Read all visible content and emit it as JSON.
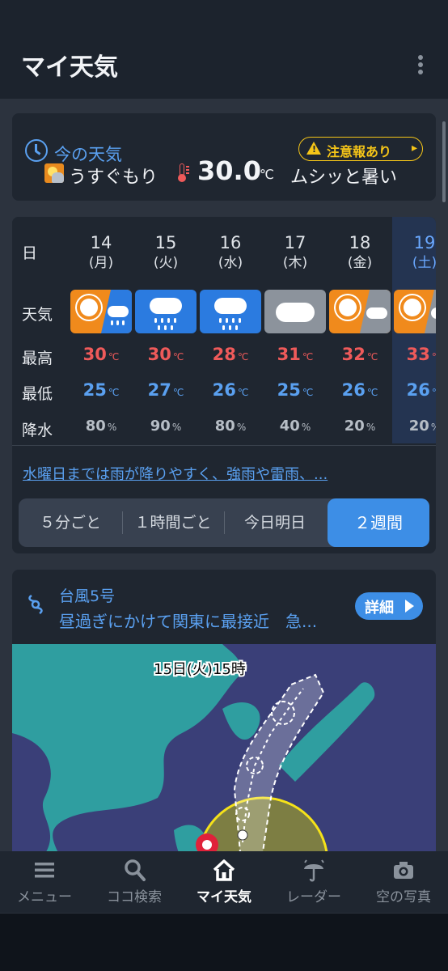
{
  "app": {
    "title": "マイ天気"
  },
  "current": {
    "label": "今の天気",
    "alert": "注意報あり",
    "condition": "うすぐもり",
    "temperature": "30.0",
    "unit": "℃",
    "feel": "ムシッと暑い"
  },
  "forecast": {
    "row_labels": {
      "day": "日",
      "weather": "天気",
      "high": "最高",
      "low": "最低",
      "rain": "降水"
    },
    "days": [
      {
        "day": "14",
        "weekday": "(月)",
        "icon": "sun-then-rain",
        "high": "30",
        "low": "25",
        "rain": "80"
      },
      {
        "day": "15",
        "weekday": "(火)",
        "icon": "rain",
        "high": "30",
        "low": "27",
        "rain": "90"
      },
      {
        "day": "16",
        "weekday": "(水)",
        "icon": "rain",
        "high": "28",
        "low": "26",
        "rain": "80"
      },
      {
        "day": "17",
        "weekday": "(木)",
        "icon": "cloudy",
        "high": "31",
        "low": "25",
        "rain": "40"
      },
      {
        "day": "18",
        "weekday": "(金)",
        "icon": "sun-then-cloud",
        "high": "32",
        "low": "26",
        "rain": "20"
      },
      {
        "day": "19",
        "weekday": "(土)",
        "icon": "sun-then-cloud",
        "high": "33",
        "low": "26",
        "rain": "20"
      }
    ],
    "temp_unit": "℃",
    "rain_unit": "%",
    "summary": "水曜日までは雨が降りやすく、強雨や雷雨、...",
    "tabs": [
      "５分ごと",
      "１時間ごと",
      "今日明日",
      "２週間"
    ],
    "selected_tab": "２週間"
  },
  "typhoon": {
    "title": "台風5号",
    "text": "昼過ぎにかけて関東に最接近　急...",
    "detail_label": "詳細",
    "map_label": "15日(火)15時"
  },
  "nav": {
    "items": [
      {
        "label": "メニュー",
        "icon": "menu-icon"
      },
      {
        "label": "ココ検索",
        "icon": "search-icon"
      },
      {
        "label": "マイ天気",
        "icon": "home-icon"
      },
      {
        "label": "レーダー",
        "icon": "umbrella-radar-icon"
      },
      {
        "label": "空の写真",
        "icon": "camera-icon"
      }
    ],
    "active": "マイ天気"
  },
  "colors": {
    "accent": "#3d8ee6",
    "high": "#ef5a5a",
    "low": "#5aa0f0",
    "alert": "#f5c518"
  }
}
